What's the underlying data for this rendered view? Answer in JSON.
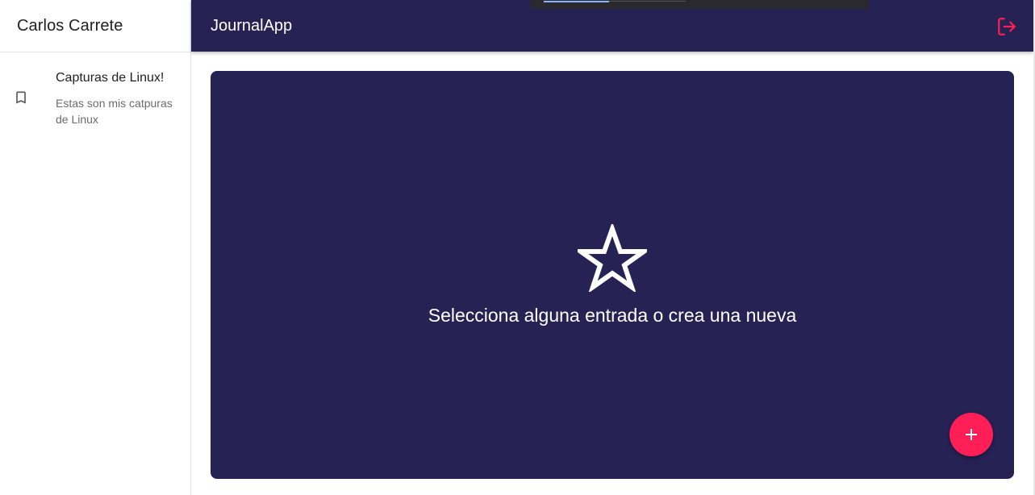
{
  "sidebar": {
    "username": "Carlos Carrete",
    "entries": [
      {
        "title": "Capturas de Linux!",
        "body": "Estas son mis catpuras de Linux",
        "icon": "bookmark-icon"
      }
    ]
  },
  "topbar": {
    "title": "JournalApp",
    "logout_icon": "logout-icon"
  },
  "main": {
    "icon": "star-icon",
    "message": "Selecciona alguna entrada o crea una nueva",
    "fab_icon": "add-icon"
  },
  "colors": {
    "primary": "#262254",
    "accent": "#ff1f56",
    "background": "#ffffff"
  }
}
